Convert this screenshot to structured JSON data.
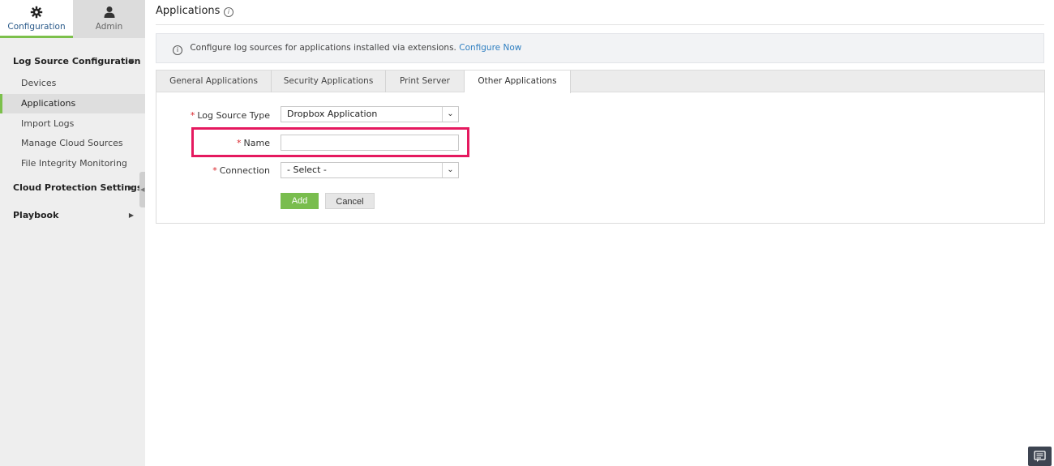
{
  "top_tabs": [
    {
      "label": "Configuration",
      "icon": "gear-icon",
      "active": true
    },
    {
      "label": "Admin",
      "icon": "user-icon",
      "active": false
    }
  ],
  "sidebar": {
    "sections": [
      {
        "label": "Log Source Configuration",
        "expanded": true,
        "items": [
          "Devices",
          "Applications",
          "Import Logs",
          "Manage Cloud Sources",
          "File Integrity Monitoring"
        ]
      },
      {
        "label": "Cloud Protection Settings",
        "expanded": false
      },
      {
        "label": "Playbook",
        "expanded": false
      }
    ],
    "active_item": "Applications"
  },
  "header": {
    "title": "Applications",
    "help": "i"
  },
  "info_bar": {
    "text": "Configure log sources for applications installed via extensions.",
    "link": "Configure Now",
    "icon": "i"
  },
  "tabs": [
    "General Applications",
    "Security Applications",
    "Print Server",
    "Other Applications"
  ],
  "active_tab": "Other Applications",
  "form": {
    "required_mark": "*",
    "log_source_type": {
      "label": "Log Source Type",
      "value": "Dropbox Application"
    },
    "name": {
      "label": "Name",
      "value": ""
    },
    "connection": {
      "label": "Connection",
      "value": "- Select -"
    },
    "add_label": "Add",
    "cancel_label": "Cancel"
  },
  "colors": {
    "accent": "#7cc04b",
    "highlight": "#e5195f",
    "link": "#2f7fc1",
    "required": "#d9262c"
  }
}
